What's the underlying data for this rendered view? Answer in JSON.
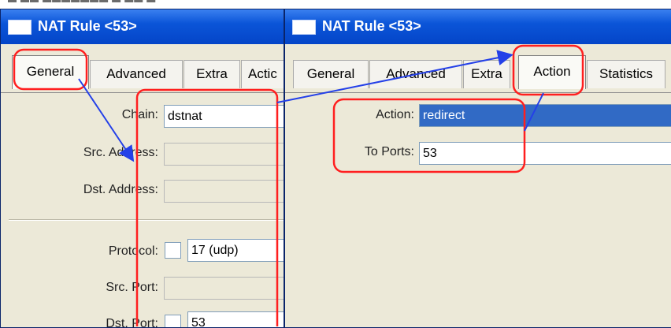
{
  "window_left": {
    "title": "NAT Rule <53>",
    "tabs": [
      "General",
      "Advanced",
      "Extra",
      "Actic"
    ],
    "active_tab": "General",
    "fields": {
      "chain_label": "Chain:",
      "chain_value": "dstnat",
      "src_address_label": "Src. Address:",
      "dst_address_label": "Dst. Address:",
      "protocol_label": "Protocol:",
      "protocol_value": "17 (udp)",
      "src_port_label": "Src. Port:",
      "dst_port_label": "Dst. Port:",
      "dst_port_value": "53"
    }
  },
  "window_right": {
    "title": "NAT Rule <53>",
    "tabs": [
      "General",
      "Advanced",
      "Extra",
      "Action",
      "Statistics"
    ],
    "active_tab": "Action",
    "fields": {
      "action_label": "Action:",
      "action_value": "redirect",
      "to_ports_label": "To Ports:",
      "to_ports_value": "53"
    }
  },
  "annotation_colors": {
    "highlight": "#ff1f1f",
    "arrow": "#2440e8"
  },
  "icons": [
    "window-icon",
    "window-icon"
  ]
}
